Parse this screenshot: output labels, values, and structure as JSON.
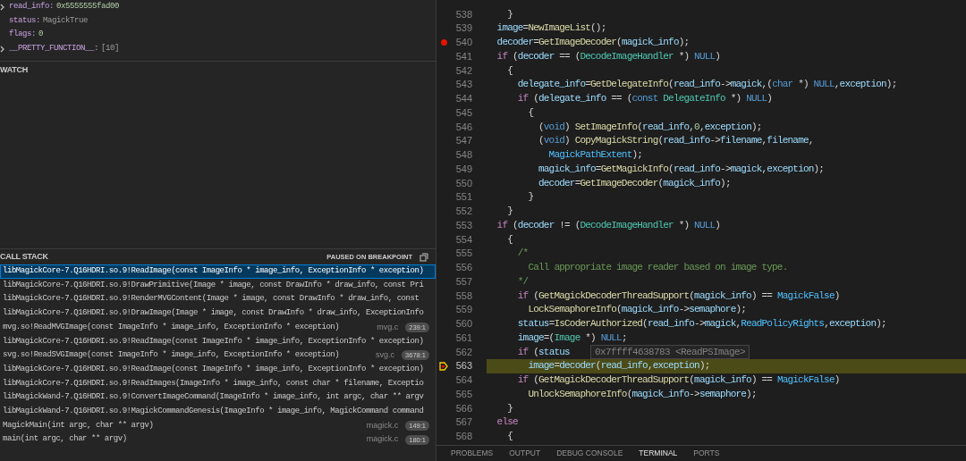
{
  "variables": [
    {
      "name": "read_info:",
      "value": "0x5555555fad00",
      "expandable": true,
      "kind": "number"
    },
    {
      "name": "status:",
      "value": "MagickTrue",
      "expandable": false,
      "kind": "plain"
    },
    {
      "name": "flags:",
      "value": "0",
      "expandable": false,
      "kind": "number"
    },
    {
      "name": "__PRETTY_FUNCTION__:",
      "value": "[10]",
      "expandable": true,
      "kind": "plain"
    }
  ],
  "watch": {
    "title": "WATCH"
  },
  "call_stack": {
    "title": "CALL STACK",
    "state": "PAUSED ON BREAKPOINT",
    "frames": [
      {
        "frame": "libMagickCore-7.Q16HDRI.so.9!ReadImage(const ImageInfo * image_info, ExceptionInfo * exception)",
        "selected": true
      },
      {
        "frame": "libMagickCore-7.Q16HDRI.so.9!DrawPrimitive(Image * image, const DrawInfo * draw_info, const Pri",
        "selected": false
      },
      {
        "frame": "libMagickCore-7.Q16HDRI.so.9!RenderMVGContent(Image * image, const DrawInfo * draw_info, const",
        "selected": false
      },
      {
        "frame": "libMagickCore-7.Q16HDRI.so.9!DrawImage(Image * image, const DrawInfo * draw_info, ExceptionInfo",
        "selected": false
      },
      {
        "frame": "mvg.so!ReadMVGImage(const ImageInfo * image_info, ExceptionInfo * exception)",
        "file": "mvg.c",
        "position": "239:1",
        "selected": false
      },
      {
        "frame": "libMagickCore-7.Q16HDRI.so.9!ReadImage(const ImageInfo * image_info, ExceptionInfo * exception)",
        "selected": false
      },
      {
        "frame": "svg.so!ReadSVGImage(const ImageInfo * image_info, ExceptionInfo * exception)",
        "file": "svg.c",
        "position": "3678:1",
        "selected": false
      },
      {
        "frame": "libMagickCore-7.Q16HDRI.so.9!ReadImage(const ImageInfo * image_info, ExceptionInfo * exception)",
        "selected": false
      },
      {
        "frame": "libMagickCore-7.Q16HDRI.so.9!ReadImages(ImageInfo * image_info, const char * filename, Exceptio",
        "selected": false
      },
      {
        "frame": "libMagickWand-7.Q16HDRI.so.9!ConvertImageCommand(ImageInfo * image_info, int argc, char ** argv",
        "selected": false
      },
      {
        "frame": "libMagickWand-7.Q16HDRI.so.9!MagickCommandGenesis(ImageInfo * image_info, MagickCommand command",
        "selected": false
      },
      {
        "frame": "MagickMain(int argc, char ** argv)",
        "file": "magick.c",
        "position": "149:1",
        "selected": false
      },
      {
        "frame": "main(int argc, char ** argv)",
        "file": "magick.c",
        "position": "180:1",
        "selected": false
      }
    ]
  },
  "editor": {
    "lines": [
      {
        "number": "538",
        "breakpoint": false,
        "current": false,
        "tokens": [
          {
            "kind": "punct",
            "text": "    }"
          }
        ]
      },
      {
        "number": "539",
        "breakpoint": false,
        "current": false,
        "tokens": [
          {
            "kind": "var",
            "text": "  image"
          },
          {
            "kind": "punct",
            "text": "="
          },
          {
            "kind": "func",
            "text": "NewImageList"
          },
          {
            "kind": "punct",
            "text": "();"
          }
        ]
      },
      {
        "number": "540",
        "breakpoint": true,
        "current": false,
        "tokens": [
          {
            "kind": "var",
            "text": "  decoder"
          },
          {
            "kind": "punct",
            "text": "="
          },
          {
            "kind": "func",
            "text": "GetImageDecoder"
          },
          {
            "kind": "punct",
            "text": "("
          },
          {
            "kind": "var",
            "text": "magick_info"
          },
          {
            "kind": "punct",
            "text": ");"
          }
        ]
      },
      {
        "number": "541",
        "breakpoint": false,
        "current": false,
        "tokens": [
          {
            "kind": "control",
            "text": "  if"
          },
          {
            "kind": "punct",
            "text": " ("
          },
          {
            "kind": "var",
            "text": "decoder"
          },
          {
            "kind": "punct",
            "text": " == ("
          },
          {
            "kind": "type",
            "text": "DecodeImageHandler"
          },
          {
            "kind": "punct",
            "text": " *) "
          },
          {
            "kind": "keyword",
            "text": "NULL"
          },
          {
            "kind": "punct",
            "text": ")"
          }
        ]
      },
      {
        "number": "542",
        "breakpoint": false,
        "current": false,
        "tokens": [
          {
            "kind": "punct",
            "text": "    {"
          }
        ]
      },
      {
        "number": "543",
        "breakpoint": false,
        "current": false,
        "tokens": [
          {
            "kind": "var",
            "text": "      delegate_info"
          },
          {
            "kind": "punct",
            "text": "="
          },
          {
            "kind": "func",
            "text": "GetDelegateInfo"
          },
          {
            "kind": "punct",
            "text": "("
          },
          {
            "kind": "var",
            "text": "read_info"
          },
          {
            "kind": "punct",
            "text": "->"
          },
          {
            "kind": "var",
            "text": "magick"
          },
          {
            "kind": "punct",
            "text": ",("
          },
          {
            "kind": "keyword",
            "text": "char"
          },
          {
            "kind": "punct",
            "text": " *) "
          },
          {
            "kind": "keyword",
            "text": "NULL"
          },
          {
            "kind": "punct",
            "text": ","
          },
          {
            "kind": "var",
            "text": "exception"
          },
          {
            "kind": "punct",
            "text": ");"
          }
        ]
      },
      {
        "number": "544",
        "breakpoint": false,
        "current": false,
        "tokens": [
          {
            "kind": "control",
            "text": "      if"
          },
          {
            "kind": "punct",
            "text": " ("
          },
          {
            "kind": "var",
            "text": "delegate_info"
          },
          {
            "kind": "punct",
            "text": " == ("
          },
          {
            "kind": "keyword",
            "text": "const"
          },
          {
            "kind": "type",
            "text": " DelegateInfo"
          },
          {
            "kind": "punct",
            "text": " *) "
          },
          {
            "kind": "keyword",
            "text": "NULL"
          },
          {
            "kind": "punct",
            "text": ")"
          }
        ]
      },
      {
        "number": "545",
        "breakpoint": false,
        "current": false,
        "tokens": [
          {
            "kind": "punct",
            "text": "        {"
          }
        ]
      },
      {
        "number": "546",
        "breakpoint": false,
        "current": false,
        "tokens": [
          {
            "kind": "punct",
            "text": "          ("
          },
          {
            "kind": "keyword",
            "text": "void"
          },
          {
            "kind": "punct",
            "text": ") "
          },
          {
            "kind": "func",
            "text": "SetImageInfo"
          },
          {
            "kind": "punct",
            "text": "("
          },
          {
            "kind": "var",
            "text": "read_info"
          },
          {
            "kind": "punct",
            "text": ","
          },
          {
            "kind": "number",
            "text": "0"
          },
          {
            "kind": "punct",
            "text": ","
          },
          {
            "kind": "var",
            "text": "exception"
          },
          {
            "kind": "punct",
            "text": ");"
          }
        ]
      },
      {
        "number": "547",
        "breakpoint": false,
        "current": false,
        "tokens": [
          {
            "kind": "punct",
            "text": "          ("
          },
          {
            "kind": "keyword",
            "text": "void"
          },
          {
            "kind": "punct",
            "text": ") "
          },
          {
            "kind": "func",
            "text": "CopyMagickString"
          },
          {
            "kind": "punct",
            "text": "("
          },
          {
            "kind": "var",
            "text": "read_info"
          },
          {
            "kind": "punct",
            "text": "->"
          },
          {
            "kind": "var",
            "text": "filename"
          },
          {
            "kind": "punct",
            "text": ","
          },
          {
            "kind": "var",
            "text": "filename"
          },
          {
            "kind": "punct",
            "text": ","
          }
        ]
      },
      {
        "number": "548",
        "breakpoint": false,
        "current": false,
        "tokens": [
          {
            "kind": "constant",
            "text": "            MagickPathExtent"
          },
          {
            "kind": "punct",
            "text": ");"
          }
        ]
      },
      {
        "number": "549",
        "breakpoint": false,
        "current": false,
        "tokens": [
          {
            "kind": "var",
            "text": "          magick_info"
          },
          {
            "kind": "punct",
            "text": "="
          },
          {
            "kind": "func",
            "text": "GetMagickInfo"
          },
          {
            "kind": "punct",
            "text": "("
          },
          {
            "kind": "var",
            "text": "read_info"
          },
          {
            "kind": "punct",
            "text": "->"
          },
          {
            "kind": "var",
            "text": "magick"
          },
          {
            "kind": "punct",
            "text": ","
          },
          {
            "kind": "var",
            "text": "exception"
          },
          {
            "kind": "punct",
            "text": ");"
          }
        ]
      },
      {
        "number": "550",
        "breakpoint": false,
        "current": false,
        "tokens": [
          {
            "kind": "var",
            "text": "          decoder"
          },
          {
            "kind": "punct",
            "text": "="
          },
          {
            "kind": "func",
            "text": "GetImageDecoder"
          },
          {
            "kind": "punct",
            "text": "("
          },
          {
            "kind": "var",
            "text": "magick_info"
          },
          {
            "kind": "punct",
            "text": ");"
          }
        ]
      },
      {
        "number": "551",
        "breakpoint": false,
        "current": false,
        "tokens": [
          {
            "kind": "punct",
            "text": "        }"
          }
        ]
      },
      {
        "number": "552",
        "breakpoint": false,
        "current": false,
        "tokens": [
          {
            "kind": "punct",
            "text": "    }"
          }
        ]
      },
      {
        "number": "553",
        "breakpoint": false,
        "current": false,
        "tokens": [
          {
            "kind": "control",
            "text": "  if"
          },
          {
            "kind": "punct",
            "text": " ("
          },
          {
            "kind": "var",
            "text": "decoder"
          },
          {
            "kind": "punct",
            "text": " != ("
          },
          {
            "kind": "type",
            "text": "DecodeImageHandler"
          },
          {
            "kind": "punct",
            "text": " *) "
          },
          {
            "kind": "keyword",
            "text": "NULL"
          },
          {
            "kind": "punct",
            "text": ")"
          }
        ]
      },
      {
        "number": "554",
        "breakpoint": false,
        "current": false,
        "tokens": [
          {
            "kind": "punct",
            "text": "    {"
          }
        ]
      },
      {
        "number": "555",
        "breakpoint": false,
        "current": false,
        "tokens": [
          {
            "kind": "comment",
            "text": "      /*"
          }
        ]
      },
      {
        "number": "556",
        "breakpoint": false,
        "current": false,
        "tokens": [
          {
            "kind": "comment",
            "text": "        Call appropriate image reader based on image type."
          }
        ]
      },
      {
        "number": "557",
        "breakpoint": false,
        "current": false,
        "tokens": [
          {
            "kind": "comment",
            "text": "      */"
          }
        ]
      },
      {
        "number": "558",
        "breakpoint": false,
        "current": false,
        "tokens": [
          {
            "kind": "control",
            "text": "      if"
          },
          {
            "kind": "punct",
            "text": " ("
          },
          {
            "kind": "func",
            "text": "GetMagickDecoderThreadSupport"
          },
          {
            "kind": "punct",
            "text": "("
          },
          {
            "kind": "var",
            "text": "magick_info"
          },
          {
            "kind": "punct",
            "text": ") == "
          },
          {
            "kind": "constant",
            "text": "MagickFalse"
          },
          {
            "kind": "punct",
            "text": ")"
          }
        ]
      },
      {
        "number": "559",
        "breakpoint": false,
        "current": false,
        "tokens": [
          {
            "kind": "func",
            "text": "        LockSemaphoreInfo"
          },
          {
            "kind": "punct",
            "text": "("
          },
          {
            "kind": "var",
            "text": "magick_info"
          },
          {
            "kind": "punct",
            "text": "->"
          },
          {
            "kind": "var",
            "text": "semaphore"
          },
          {
            "kind": "punct",
            "text": ");"
          }
        ]
      },
      {
        "number": "560",
        "breakpoint": false,
        "current": false,
        "tokens": [
          {
            "kind": "var",
            "text": "      status"
          },
          {
            "kind": "punct",
            "text": "="
          },
          {
            "kind": "func",
            "text": "IsCoderAuthorized"
          },
          {
            "kind": "punct",
            "text": "("
          },
          {
            "kind": "var",
            "text": "read_info"
          },
          {
            "kind": "punct",
            "text": "->"
          },
          {
            "kind": "var",
            "text": "magick"
          },
          {
            "kind": "punct",
            "text": ","
          },
          {
            "kind": "constant",
            "text": "ReadPolicyRights"
          },
          {
            "kind": "punct",
            "text": ","
          },
          {
            "kind": "var",
            "text": "exception"
          },
          {
            "kind": "punct",
            "text": ");"
          }
        ]
      },
      {
        "number": "561",
        "breakpoint": false,
        "current": false,
        "tokens": [
          {
            "kind": "var",
            "text": "      image"
          },
          {
            "kind": "punct",
            "text": "=("
          },
          {
            "kind": "type",
            "text": "Image"
          },
          {
            "kind": "punct",
            "text": " *) "
          },
          {
            "kind": "keyword",
            "text": "NULL"
          },
          {
            "kind": "punct",
            "text": ";"
          }
        ]
      },
      {
        "number": "562",
        "breakpoint": false,
        "current": false,
        "tokens": [
          {
            "kind": "control",
            "text": "      if"
          },
          {
            "kind": "punct",
            "text": " ("
          },
          {
            "kind": "var",
            "text": "status"
          }
        ]
      },
      {
        "number": "563",
        "breakpoint": false,
        "current": true,
        "tokens": [
          {
            "kind": "var",
            "text": "        image"
          },
          {
            "kind": "punct",
            "text": "="
          },
          {
            "kind": "var",
            "text": "decoder"
          },
          {
            "kind": "punct",
            "text": "("
          },
          {
            "kind": "var",
            "text": "read_info"
          },
          {
            "kind": "punct",
            "text": ","
          },
          {
            "kind": "var",
            "text": "exception"
          },
          {
            "kind": "punct",
            "text": ");"
          }
        ]
      },
      {
        "number": "564",
        "breakpoint": false,
        "current": false,
        "tokens": [
          {
            "kind": "control",
            "text": "      if"
          },
          {
            "kind": "punct",
            "text": " ("
          },
          {
            "kind": "func",
            "text": "GetMagickDecoderThreadSupport"
          },
          {
            "kind": "punct",
            "text": "("
          },
          {
            "kind": "var",
            "text": "magick_info"
          },
          {
            "kind": "punct",
            "text": ") == "
          },
          {
            "kind": "constant",
            "text": "MagickFalse"
          },
          {
            "kind": "punct",
            "text": ")"
          }
        ]
      },
      {
        "number": "565",
        "breakpoint": false,
        "current": false,
        "tokens": [
          {
            "kind": "func",
            "text": "        UnlockSemaphoreInfo"
          },
          {
            "kind": "punct",
            "text": "("
          },
          {
            "kind": "var",
            "text": "magick_info"
          },
          {
            "kind": "punct",
            "text": "->"
          },
          {
            "kind": "var",
            "text": "semaphore"
          },
          {
            "kind": "punct",
            "text": ");"
          }
        ]
      },
      {
        "number": "566",
        "breakpoint": false,
        "current": false,
        "tokens": [
          {
            "kind": "punct",
            "text": "    }"
          }
        ]
      },
      {
        "number": "567",
        "breakpoint": false,
        "current": false,
        "tokens": [
          {
            "kind": "control",
            "text": "  else"
          }
        ]
      },
      {
        "number": "568",
        "breakpoint": false,
        "current": false,
        "tokens": [
          {
            "kind": "punct",
            "text": "    {"
          }
        ]
      }
    ],
    "hover": {
      "text": "0x7ffff4638783 <ReadPSImage>"
    }
  },
  "panel_tabs": [
    {
      "label": "PROBLEMS",
      "selected": false
    },
    {
      "label": "OUTPUT",
      "selected": false
    },
    {
      "label": "DEBUG CONSOLE",
      "selected": false
    },
    {
      "label": "TERMINAL",
      "selected": true
    },
    {
      "label": "PORTS",
      "selected": false
    }
  ]
}
